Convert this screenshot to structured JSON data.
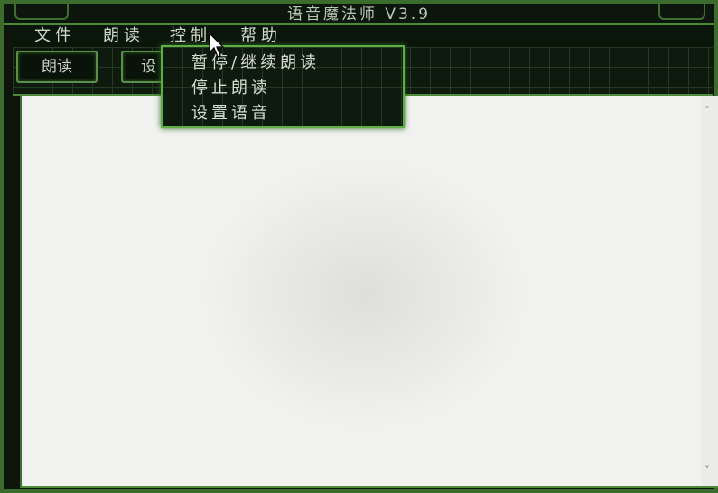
{
  "window": {
    "title": "语音魔法师 V3.9"
  },
  "menubar": {
    "items": [
      "文件",
      "朗读",
      "控制",
      "帮助"
    ]
  },
  "toolbar": {
    "read_label": "朗读",
    "settings_label_partial": "设"
  },
  "dropdown": {
    "items": [
      "暂停/继续朗读",
      "停止朗读",
      "设置语音"
    ]
  },
  "colors": {
    "accent": "#5fae43",
    "background": "#0f1a0f",
    "editor": "#f1f1ef"
  }
}
